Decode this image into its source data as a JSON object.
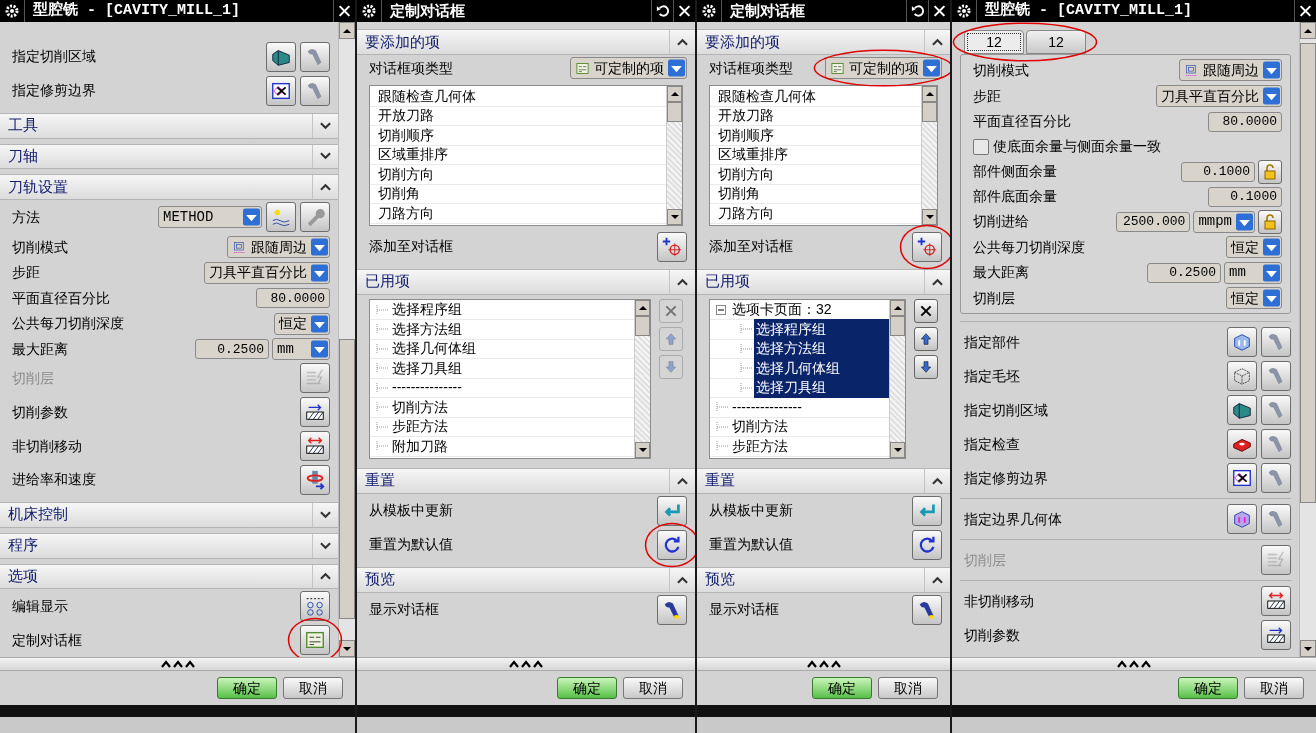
{
  "panels": [
    {
      "kind": "operation",
      "title": "型腔铣 - [CAVITY_MILL_1]",
      "title_buttons": [
        {
          "kind": "close"
        }
      ],
      "scrollbar": true,
      "items": [
        {
          "kind": "icon_row",
          "label": "指定切削区域",
          "icons": [
            {
              "kind": "cut-area"
            },
            {
              "kind": "flashlight"
            }
          ]
        },
        {
          "kind": "icon_row",
          "label": "指定修剪边界",
          "icons": [
            {
              "kind": "trim-boundary"
            },
            {
              "kind": "flashlight"
            }
          ]
        },
        {
          "kind": "header",
          "label": "工具",
          "expanded": false
        },
        {
          "kind": "header",
          "label": "刀轴",
          "expanded": false
        },
        {
          "kind": "header",
          "label": "刀轨设置",
          "expanded": true
        },
        {
          "kind": "method",
          "label": "方法",
          "value": "METHOD",
          "icons": [
            {
              "kind": "method-new"
            },
            {
              "kind": "wrench"
            }
          ]
        },
        {
          "kind": "dropdown",
          "label": "切削模式",
          "value": "跟随周边",
          "icon": {
            "kind": "pattern"
          }
        },
        {
          "kind": "dropdown",
          "label": "步距",
          "value": "刀具平直百分比"
        },
        {
          "kind": "number",
          "label": "平面直径百分比",
          "value": "80.0000"
        },
        {
          "kind": "dropdown",
          "label": "公共每刀切削深度",
          "value": "恒定"
        },
        {
          "kind": "number",
          "label": "最大距离",
          "value": "0.2500",
          "unit": "mm"
        },
        {
          "kind": "icon_row",
          "label": "切削层",
          "disabled": true,
          "icons": [
            {
              "kind": "cut-levels"
            }
          ]
        },
        {
          "kind": "icon_row",
          "label": "切削参数",
          "icons": [
            {
              "kind": "cut-params"
            }
          ]
        },
        {
          "kind": "icon_row",
          "label": "非切削移动",
          "icons": [
            {
              "kind": "non-cut"
            }
          ]
        },
        {
          "kind": "icon_row",
          "label": "进给率和速度",
          "icons": [
            {
              "kind": "feeds"
            }
          ]
        },
        {
          "kind": "header",
          "label": "机床控制",
          "expanded": false
        },
        {
          "kind": "header",
          "label": "程序",
          "expanded": false
        },
        {
          "kind": "header",
          "label": "选项",
          "expanded": true
        },
        {
          "kind": "icon_row",
          "label": "编辑显示",
          "icons": [
            {
              "kind": "edit-display"
            }
          ]
        },
        {
          "kind": "icon_row",
          "label": "定制对话框",
          "icons": [
            {
              "kind": "customize"
            }
          ],
          "circled": true
        }
      ],
      "buttons": [
        {
          "label": "确定",
          "kind": "ok"
        },
        {
          "label": "取消",
          "kind": "cancel"
        }
      ]
    },
    {
      "kind": "customize",
      "title": "定制对话框",
      "title_buttons": [
        {
          "kind": "reset"
        },
        {
          "kind": "close"
        }
      ],
      "items": [
        {
          "kind": "header",
          "label": "要添加的项",
          "expanded": true
        },
        {
          "kind": "dropdown",
          "label": "对话框项类型",
          "value": "可定制的项",
          "icon": {
            "kind": "dialog"
          }
        },
        {
          "kind": "list",
          "rows": [
            {
              "label": "跟随检查几何体",
              "selected": false
            },
            {
              "label": "开放刀路",
              "selected": false
            },
            {
              "label": "切削顺序",
              "selected": false
            },
            {
              "label": "区域重排序",
              "selected": false
            },
            {
              "label": "切削方向",
              "selected": false
            },
            {
              "label": "切削角",
              "selected": false
            },
            {
              "label": "刀路方向",
              "selected": false
            }
          ]
        },
        {
          "kind": "icon_row",
          "label": "添加至对话框",
          "icons": [
            {
              "kind": "add"
            }
          ]
        },
        {
          "kind": "header",
          "label": "已用项",
          "expanded": true
        },
        {
          "kind": "list",
          "tree": true,
          "side_buttons": [
            {
              "kind": "delete",
              "disabled": true
            },
            {
              "kind": "up",
              "disabled": true
            },
            {
              "kind": "down",
              "disabled": true
            }
          ],
          "rows": [
            {
              "label": "选择程序组",
              "selected": false
            },
            {
              "label": "选择方法组",
              "selected": false
            },
            {
              "label": "选择几何体组",
              "selected": false
            },
            {
              "label": "选择刀具组",
              "selected": false
            },
            {
              "label": "---------------",
              "selected": false
            },
            {
              "label": "切削方法",
              "selected": false
            },
            {
              "label": "步距方法",
              "selected": false
            },
            {
              "label": "附加刀路",
              "selected": false
            }
          ]
        },
        {
          "kind": "header",
          "label": "重置",
          "expanded": true
        },
        {
          "kind": "icon_row",
          "label": "从模板中更新",
          "icons": [
            {
              "kind": "update"
            }
          ]
        },
        {
          "kind": "icon_row",
          "label": "重置为默认值",
          "icons": [
            {
              "kind": "reset"
            }
          ],
          "circled": true
        },
        {
          "kind": "header",
          "label": "预览",
          "expanded": true
        },
        {
          "kind": "icon_row",
          "label": "显示对话框",
          "icons": [
            {
              "kind": "show"
            }
          ]
        }
      ],
      "buttons": [
        {
          "label": "确定",
          "kind": "ok"
        },
        {
          "label": "取消",
          "kind": "cancel"
        }
      ]
    },
    {
      "kind": "customize",
      "title": "定制对话框",
      "title_buttons": [
        {
          "kind": "reset"
        },
        {
          "kind": "close"
        }
      ],
      "items": [
        {
          "kind": "header",
          "label": "要添加的项",
          "expanded": true
        },
        {
          "kind": "dropdown",
          "label": "对话框项类型",
          "value": "可定制的项",
          "icon": {
            "kind": "dialog"
          },
          "circled": true
        },
        {
          "kind": "list",
          "rows": [
            {
              "label": "跟随检查几何体",
              "selected": false
            },
            {
              "label": "开放刀路",
              "selected": false
            },
            {
              "label": "切削顺序",
              "selected": false
            },
            {
              "label": "区域重排序",
              "selected": false
            },
            {
              "label": "切削方向",
              "selected": false
            },
            {
              "label": "切削角",
              "selected": false
            },
            {
              "label": "刀路方向",
              "selected": false
            }
          ]
        },
        {
          "kind": "icon_row",
          "label": "添加至对话框",
          "icons": [
            {
              "kind": "add"
            }
          ],
          "circled": true
        },
        {
          "kind": "header",
          "label": "已用项",
          "expanded": true
        },
        {
          "kind": "list",
          "tree": true,
          "side_buttons": [
            {
              "kind": "delete",
              "disabled": false
            },
            {
              "kind": "up",
              "disabled": false
            },
            {
              "kind": "down",
              "disabled": false
            }
          ],
          "rows": [
            {
              "label": "选项卡页面：32",
              "selected": false,
              "expanded": true,
              "children": [
                {
                  "label": "选择程序组",
                  "selected": true
                },
                {
                  "label": "选择方法组",
                  "selected": true
                },
                {
                  "label": "选择几何体组",
                  "selected": true
                },
                {
                  "label": "选择刀具组",
                  "selected": true
                }
              ]
            },
            {
              "label": "---------------",
              "selected": false
            },
            {
              "label": "切削方法",
              "selected": false
            },
            {
              "label": "步距方法",
              "selected": false
            }
          ]
        },
        {
          "kind": "header",
          "label": "重置",
          "expanded": true
        },
        {
          "kind": "icon_row",
          "label": "从模板中更新",
          "icons": [
            {
              "kind": "update"
            }
          ]
        },
        {
          "kind": "icon_row",
          "label": "重置为默认值",
          "icons": [
            {
              "kind": "reset"
            }
          ]
        },
        {
          "kind": "header",
          "label": "预览",
          "expanded": true
        },
        {
          "kind": "icon_row",
          "label": "显示对话框",
          "icons": [
            {
              "kind": "show"
            }
          ]
        }
      ],
      "buttons": [
        {
          "label": "确定",
          "kind": "ok"
        },
        {
          "label": "取消",
          "kind": "cancel"
        }
      ]
    },
    {
      "kind": "operation",
      "title": "型腔铣 - [CAVITY_MILL_1]",
      "title_buttons": [
        {
          "kind": "close"
        }
      ],
      "scrollbar": true,
      "items": [
        {
          "kind": "tabs",
          "circled": true,
          "tabs": [
            {
              "label": "12",
              "selected": true
            },
            {
              "label": "12",
              "selected": false
            }
          ]
        },
        {
          "kind": "group",
          "items": [
            {
              "kind": "dropdown",
              "label": "切削模式",
              "value": "跟随周边",
              "icon": {
                "kind": "pattern"
              }
            },
            {
              "kind": "dropdown",
              "label": "步距",
              "value": "刀具平直百分比"
            },
            {
              "kind": "number",
              "label": "平面直径百分比",
              "value": "80.0000"
            },
            {
              "kind": "checkbox",
              "label": "使底面余量与侧面余量一致",
              "checked": false
            },
            {
              "kind": "number",
              "label": "部件侧面余量",
              "value": "0.1000",
              "lock": true
            },
            {
              "kind": "number",
              "label": "部件底面余量",
              "value": "0.1000"
            },
            {
              "kind": "number",
              "label": "切削进给",
              "value": "2500.000",
              "unit": "mmpm",
              "lock": true
            },
            {
              "kind": "dropdown",
              "label": "公共每刀切削深度",
              "value": "恒定"
            },
            {
              "kind": "number",
              "label": "最大距离",
              "value": "0.2500",
              "unit": "mm"
            },
            {
              "kind": "dropdown",
              "label": "切削层",
              "value": "恒定"
            }
          ]
        },
        {
          "kind": "separator"
        },
        {
          "kind": "icon_row",
          "label": "指定部件",
          "icons": [
            {
              "kind": "part"
            },
            {
              "kind": "flashlight"
            }
          ]
        },
        {
          "kind": "icon_row",
          "label": "指定毛坯",
          "icons": [
            {
              "kind": "blank"
            },
            {
              "kind": "flashlight"
            }
          ]
        },
        {
          "kind": "icon_row",
          "label": "指定切削区域",
          "icons": [
            {
              "kind": "cut-area"
            },
            {
              "kind": "flashlight"
            }
          ]
        },
        {
          "kind": "icon_row",
          "label": "指定检查",
          "icons": [
            {
              "kind": "check"
            },
            {
              "kind": "flashlight"
            }
          ]
        },
        {
          "kind": "icon_row",
          "label": "指定修剪边界",
          "icons": [
            {
              "kind": "trim-boundary"
            },
            {
              "kind": "flashlight"
            }
          ]
        },
        {
          "kind": "separator"
        },
        {
          "kind": "icon_row",
          "label": "指定边界几何体",
          "icons": [
            {
              "kind": "boundary-geom"
            },
            {
              "kind": "flashlight"
            }
          ]
        },
        {
          "kind": "separator"
        },
        {
          "kind": "icon_row",
          "label": "切削层",
          "disabled": true,
          "icons": [
            {
              "kind": "cut-levels"
            }
          ]
        },
        {
          "kind": "separator"
        },
        {
          "kind": "icon_row",
          "label": "非切削移动",
          "icons": [
            {
              "kind": "non-cut"
            }
          ]
        },
        {
          "kind": "icon_row",
          "label": "切削参数",
          "icons": [
            {
              "kind": "cut-params"
            }
          ]
        }
      ],
      "buttons": [
        {
          "label": "确定",
          "kind": "ok"
        },
        {
          "label": "取消",
          "kind": "cancel"
        }
      ]
    }
  ]
}
